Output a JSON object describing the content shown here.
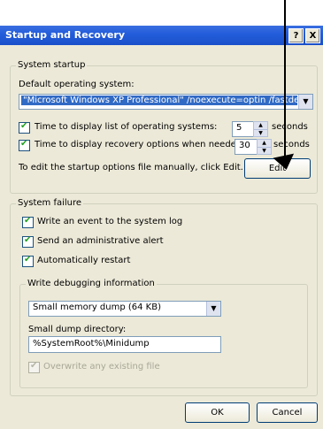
{
  "window": {
    "title": "Startup and Recovery",
    "help_label": "?",
    "close_label": "X"
  },
  "system_startup": {
    "group_label": "System startup",
    "default_os_label": "Default operating system:",
    "default_os_value": "\"Microsoft Windows XP Professional\" /noexecute=optin /fastdetect",
    "time_os_label": "Time to display list of operating systems:",
    "time_os_value": "5",
    "time_os_unit": "seconds",
    "time_recovery_label": "Time to display recovery options when needed:",
    "time_recovery_value": "30",
    "time_recovery_unit": "seconds",
    "edit_hint": "To edit the startup options file manually, click Edit.",
    "edit_button": "Edit"
  },
  "system_failure": {
    "group_label": "System failure",
    "write_event": "Write an event to the system log",
    "send_alert": "Send an administrative alert",
    "auto_restart": "Automatically restart"
  },
  "debug_info": {
    "group_label": "Write debugging information",
    "dump_type": "Small memory dump (64 KB)",
    "dump_dir_label": "Small dump directory:",
    "dump_dir_value": "%SystemRoot%\\Minidump",
    "overwrite_label": "Overwrite any existing file"
  },
  "footer": {
    "ok_label": "OK",
    "cancel_label": "Cancel"
  },
  "colors": {
    "titlebar": "#245edb",
    "dialog_bg": "#ece9d8",
    "selection": "#316ac5"
  }
}
